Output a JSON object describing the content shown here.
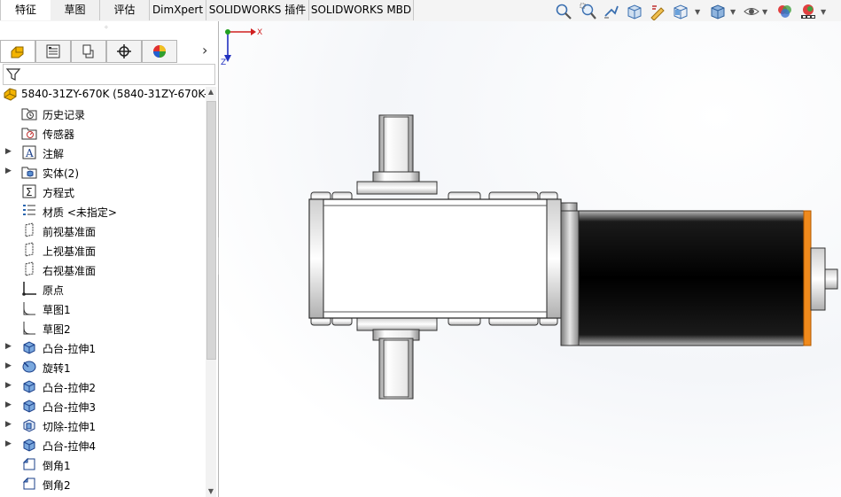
{
  "tabs": [
    {
      "label": "特征"
    },
    {
      "label": "草图"
    },
    {
      "label": "评估"
    },
    {
      "label": "DimXpert"
    },
    {
      "label": "SOLIDWORKS 插件"
    },
    {
      "label": "SOLIDWORKS MBD"
    }
  ],
  "view_tools": [
    "zoom-to-fit-icon",
    "zoom-area-icon",
    "previous-view-icon",
    "section-view-icon",
    "dynamic-annotation-icon",
    "view-orientation-icon",
    "display-style-icon",
    "hide-show-icon",
    "edit-appearance-icon",
    "apply-scene-icon"
  ],
  "manager_tabs": [
    "feature-manager-icon",
    "property-manager-icon",
    "configuration-manager-icon",
    "dimxpert-manager-icon",
    "display-manager-icon"
  ],
  "tree": {
    "root": "5840-31ZY-670K  (5840-31ZY-670K-",
    "items": [
      {
        "label": "历史记录",
        "expandable": false,
        "icon": "history-folder-icon"
      },
      {
        "label": "传感器",
        "expandable": false,
        "icon": "sensor-folder-icon"
      },
      {
        "label": "注解",
        "expandable": true,
        "icon": "annotations-icon"
      },
      {
        "label": "实体(2)",
        "expandable": true,
        "icon": "solid-bodies-icon"
      },
      {
        "label": "方程式",
        "expandable": false,
        "icon": "equations-icon"
      },
      {
        "label": "材质 <未指定>",
        "expandable": false,
        "icon": "material-icon"
      },
      {
        "label": "前视基准面",
        "expandable": false,
        "icon": "plane-icon"
      },
      {
        "label": "上视基准面",
        "expandable": false,
        "icon": "plane-icon"
      },
      {
        "label": "右视基准面",
        "expandable": false,
        "icon": "plane-icon"
      },
      {
        "label": "原点",
        "expandable": false,
        "icon": "origin-icon"
      },
      {
        "label": "草图1",
        "expandable": false,
        "icon": "sketch-icon"
      },
      {
        "label": "草图2",
        "expandable": false,
        "icon": "sketch-icon"
      },
      {
        "label": "凸台-拉伸1",
        "expandable": true,
        "icon": "boss-extrude-icon"
      },
      {
        "label": "旋转1",
        "expandable": true,
        "icon": "revolve-icon"
      },
      {
        "label": "凸台-拉伸2",
        "expandable": true,
        "icon": "boss-extrude-icon"
      },
      {
        "label": "凸台-拉伸3",
        "expandable": true,
        "icon": "boss-extrude-icon"
      },
      {
        "label": "切除-拉伸1",
        "expandable": true,
        "icon": "cut-extrude-icon"
      },
      {
        "label": "凸台-拉伸4",
        "expandable": true,
        "icon": "boss-extrude-icon"
      },
      {
        "label": "倒角1",
        "expandable": false,
        "icon": "chamfer-icon"
      },
      {
        "label": "倒角2",
        "expandable": false,
        "icon": "chamfer-icon"
      }
    ]
  },
  "triad": {
    "x_label": "X",
    "z_label": "Z"
  },
  "colors": {
    "accent_orange": "#f08a1c",
    "motor_body": "#111111",
    "tab_border": "#c8c8c8"
  }
}
